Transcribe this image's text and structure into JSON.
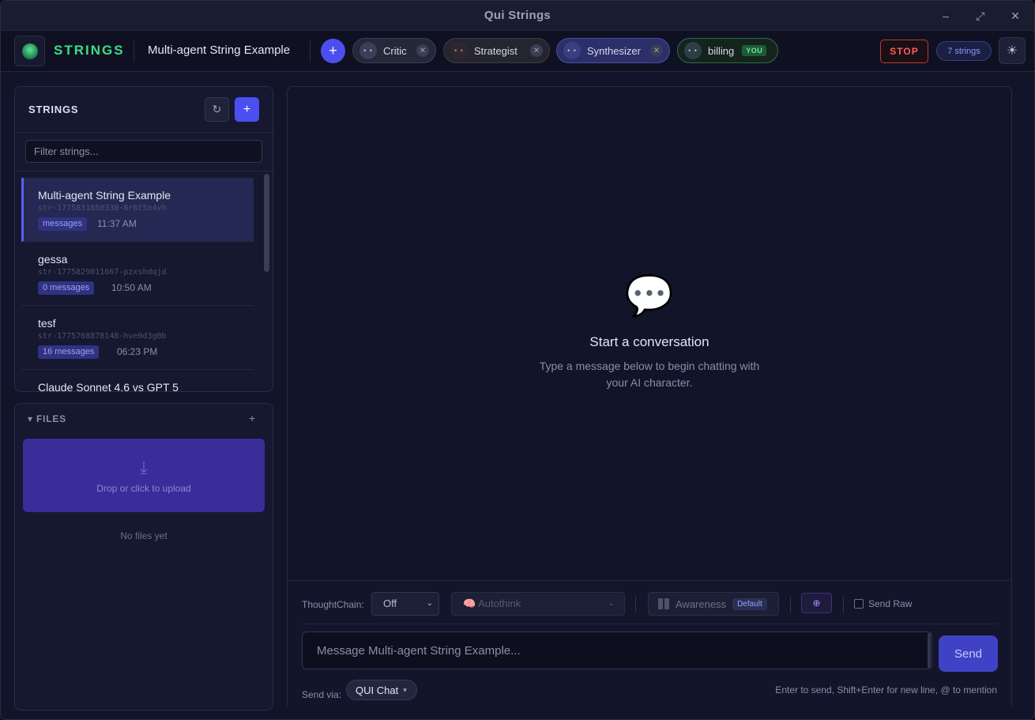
{
  "window": {
    "title": "Qui Strings"
  },
  "header": {
    "brand": "STRINGS",
    "string_title": "Multi-agent String Example",
    "add_agent_label": "+",
    "agents": [
      {
        "name": "Critic",
        "avatar": "• •"
      },
      {
        "name": "Strategist",
        "avatar": "• •"
      },
      {
        "name": "Synthesizer",
        "avatar": "• •"
      },
      {
        "name": "billing",
        "avatar": "• •",
        "badge": "YOU"
      }
    ],
    "stop_label": "STOP",
    "strings_count": "7 strings"
  },
  "strings_panel": {
    "title": "STRINGS",
    "add_label": "+",
    "filter_placeholder": "Filter strings...",
    "items": [
      {
        "name": "Multi-agent String Example",
        "id": "str-1775831850338-8r6t5n4vh",
        "badge": "messages",
        "time": "11:37 AM"
      },
      {
        "name": "gessa",
        "id": "str-1775829011667-pzxshdqjd",
        "badge": "0 messages",
        "time": "10:50 AM"
      },
      {
        "name": "tesf",
        "id": "str-1775768878148-hve0d3g0b",
        "badge": "16 messages",
        "time": "06:23 PM"
      },
      {
        "name": "Claude Sonnet 4.6 vs GPT 5"
      }
    ]
  },
  "files_panel": {
    "title": "FILES",
    "add_label": "+",
    "drop_text": "Drop or click to upload",
    "empty_text": "No files yet"
  },
  "chat": {
    "empty_title": "Start a conversation",
    "empty_subtitle": "Type a message below to begin chatting with your AI character."
  },
  "composer": {
    "thoughtchain_label": "ThoughtChain:",
    "thoughtchain_value": "Off",
    "autothink_label": "🧠 Autothink",
    "awareness_label": "Awareness",
    "awareness_badge": "Default",
    "send_raw_label": "Send Raw",
    "message_placeholder": "Message Multi-agent String Example...",
    "send_label": "Send",
    "send_via_label": "Send via:",
    "send_via_value": "QUI Chat",
    "hint": "Enter to send, Shift+Enter for new line, @ to mention"
  }
}
